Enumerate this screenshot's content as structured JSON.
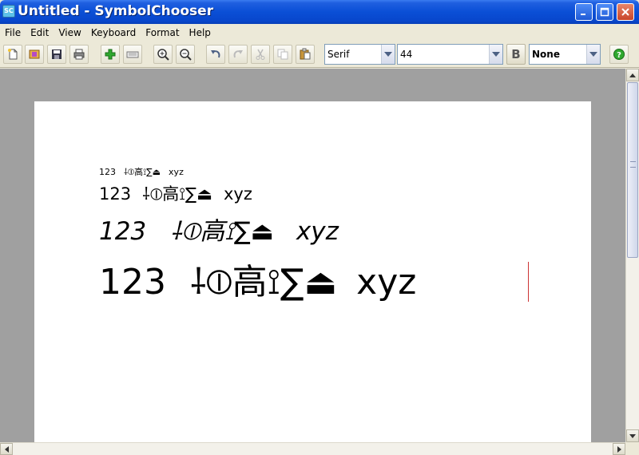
{
  "window": {
    "app_icon_label": "SC",
    "title": "Untitled - SymbolChooser"
  },
  "menu": [
    "File",
    "Edit",
    "View",
    "Keyboard",
    "Format",
    "Help"
  ],
  "toolbar": {
    "icons": [
      "new-icon",
      "open-icon",
      "save-icon",
      "print-icon",
      "add-icon",
      "keyboard-icon",
      "zoom-in-icon",
      "zoom-out-icon",
      "undo-icon",
      "redo-icon",
      "cut-icon",
      "copy-icon",
      "paste-icon",
      "help-icon"
    ],
    "font_family": "Serif",
    "font_size": "44",
    "bold_label": "B",
    "style": "None"
  },
  "document": {
    "lines": [
      {
        "numbers": "123",
        "symbols": "⸸⦶高⟟∑⏏",
        "letters": "xyz"
      },
      {
        "numbers": "123",
        "symbols": "⸸⦶高⟟∑⏏",
        "letters": "xyz"
      },
      {
        "numbers": "123",
        "symbols": "⸸⦶高⟟∑⏏",
        "letters": "xyz"
      },
      {
        "numbers": "123",
        "symbols": "⸸⦶高⟟∑⏏",
        "letters": "xyz"
      }
    ]
  },
  "colors": {
    "titlebar": "#0a4fd6",
    "caret": "#cc3333",
    "add_icon": "#2fa82f",
    "help_icon": "#2fa82f"
  }
}
